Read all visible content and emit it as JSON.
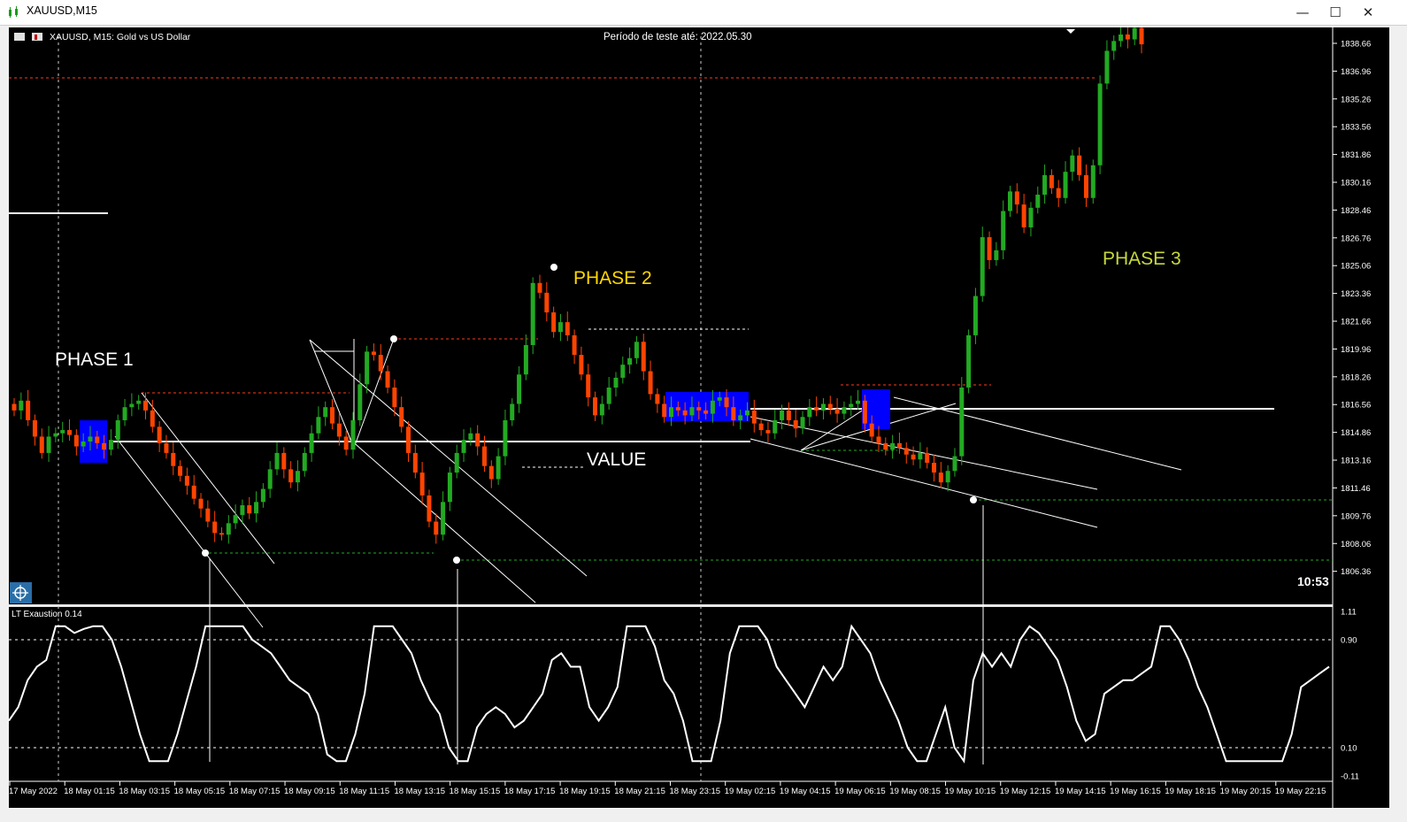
{
  "window": {
    "title": "XAUUSD,M15",
    "icon": "chart-icon",
    "buttons": {
      "minimize": "—",
      "maximize": "☐",
      "close": "✕"
    }
  },
  "chart_header": {
    "symbol_line": "XAUUSD, M15:  Gold vs US Dollar",
    "test_period": "Período de teste até: 2022.05.30",
    "clock": "10:53"
  },
  "annotations": {
    "phase1": "PHASE 1",
    "phase2": "PHASE 2",
    "phase3": "PHASE 3",
    "value": "VALUE"
  },
  "indicator": {
    "name": "LT Exaustion 0.14",
    "scale_labels": [
      "1.11",
      "0.90",
      "0.10",
      "-0.11"
    ],
    "levels": {
      "upper": 0.9,
      "lower": 0.1,
      "max": 1.11,
      "min": -0.11
    }
  },
  "colors": {
    "background": "#000000",
    "bull": "#22aa22",
    "bear": "#ff4400",
    "phase1_text": "#ffffff",
    "phase2_text": "#ffd700",
    "phase3_text": "#c8d83a",
    "box": "#0000ff"
  },
  "chart_data": {
    "type": "candlestick",
    "symbol": "XAUUSD",
    "timeframe": "M15",
    "y_ticks": [
      "1838.66",
      "1836.96",
      "1835.26",
      "1833.56",
      "1831.86",
      "1830.16",
      "1828.46",
      "1826.76",
      "1825.06",
      "1823.36",
      "1821.66",
      "1819.96",
      "1818.26",
      "1816.56",
      "1814.86",
      "1813.16",
      "1811.46",
      "1809.76",
      "1808.06",
      "1806.36"
    ],
    "ylim": [
      1805.8,
      1839.2
    ],
    "x_ticks": [
      "17 May 2022",
      "18 May 01:15",
      "18 May 03:15",
      "18 May 05:15",
      "18 May 07:15",
      "18 May 09:15",
      "18 May 11:15",
      "18 May 13:15",
      "18 May 15:15",
      "18 May 17:15",
      "18 May 19:15",
      "18 May 21:15",
      "18 May 23:15",
      "19 May 02:15",
      "19 May 04:15",
      "19 May 06:15",
      "19 May 08:15",
      "19 May 10:15",
      "19 May 12:15",
      "19 May 14:15",
      "19 May 16:15",
      "19 May 18:15",
      "19 May 20:15",
      "19 May 22:15"
    ],
    "closes": [
      1816.2,
      1816.8,
      1815.6,
      1814.6,
      1813.6,
      1814.6,
      1814.8,
      1815.0,
      1814.7,
      1814.0,
      1814.3,
      1814.6,
      1814.2,
      1813.8,
      1814.4,
      1815.6,
      1816.4,
      1816.6,
      1816.8,
      1816.2,
      1815.2,
      1814.2,
      1813.6,
      1812.8,
      1812.2,
      1811.6,
      1810.8,
      1810.2,
      1809.4,
      1808.7,
      1808.6,
      1809.3,
      1809.8,
      1810.4,
      1809.9,
      1810.6,
      1811.4,
      1812.6,
      1813.6,
      1812.6,
      1811.8,
      1812.5,
      1813.6,
      1814.8,
      1815.8,
      1816.4,
      1815.4,
      1814.6,
      1813.8,
      1815.6,
      1817.8,
      1819.8,
      1819.6,
      1818.6,
      1817.6,
      1816.4,
      1815.2,
      1813.6,
      1812.4,
      1811.0,
      1809.4,
      1808.6,
      1810.6,
      1812.4,
      1813.6,
      1814.4,
      1814.8,
      1814.0,
      1812.8,
      1812.0,
      1813.4,
      1815.6,
      1816.6,
      1818.4,
      1820.2,
      1824.0,
      1823.4,
      1822.2,
      1821.0,
      1821.6,
      1820.8,
      1819.6,
      1818.4,
      1817.0,
      1815.9,
      1816.6,
      1817.6,
      1818.2,
      1819.0,
      1819.4,
      1820.4,
      1818.6,
      1817.2,
      1816.6,
      1815.8,
      1816.4,
      1816.2,
      1815.9,
      1816.4,
      1816.2,
      1816.0,
      1816.8,
      1817.0,
      1816.4,
      1815.6,
      1815.9,
      1816.2,
      1815.4,
      1815.0,
      1814.8,
      1815.6,
      1816.2,
      1815.6,
      1815.1,
      1815.8,
      1816.4,
      1816.2,
      1816.6,
      1816.3,
      1816.0,
      1816.4,
      1816.6,
      1816.8,
      1815.4,
      1814.6,
      1814.2,
      1813.8,
      1814.2,
      1813.9,
      1813.5,
      1813.2,
      1813.6,
      1813.0,
      1812.4,
      1811.8,
      1812.5,
      1813.4,
      1817.6,
      1820.8,
      1823.2,
      1826.8,
      1825.4,
      1826.0,
      1828.4,
      1829.6,
      1828.8,
      1827.4,
      1828.6,
      1829.4,
      1830.6,
      1829.8,
      1829.2,
      1830.8,
      1831.8,
      1830.6,
      1829.2,
      1831.2,
      1836.2,
      1838.2,
      1838.8,
      1839.2,
      1838.9,
      1839.6,
      1838.6
    ],
    "series_names": [
      "XAUUSD M15"
    ]
  },
  "osc_data": [
    0.3,
    0.4,
    0.6,
    0.7,
    0.75,
    1.0,
    1.0,
    0.95,
    0.98,
    1.0,
    1.0,
    0.9,
    0.7,
    0.45,
    0.2,
    0.0,
    0.0,
    0.0,
    0.2,
    0.45,
    0.7,
    1.0,
    1.0,
    1.0,
    1.0,
    1.0,
    0.9,
    0.85,
    0.8,
    0.7,
    0.6,
    0.55,
    0.5,
    0.35,
    0.05,
    0.0,
    0.0,
    0.2,
    0.5,
    1.0,
    1.0,
    1.0,
    0.9,
    0.8,
    0.6,
    0.45,
    0.35,
    0.1,
    0.0,
    0.0,
    0.25,
    0.35,
    0.4,
    0.35,
    0.25,
    0.3,
    0.4,
    0.5,
    0.75,
    0.8,
    0.7,
    0.7,
    0.4,
    0.3,
    0.4,
    0.55,
    1.0,
    1.0,
    1.0,
    0.85,
    0.6,
    0.5,
    0.3,
    0.0,
    0.0,
    0.0,
    0.3,
    0.8,
    1.0,
    1.0,
    1.0,
    0.9,
    0.7,
    0.6,
    0.5,
    0.4,
    0.55,
    0.7,
    0.6,
    0.7,
    1.0,
    0.9,
    0.8,
    0.6,
    0.45,
    0.3,
    0.1,
    0.0,
    0.0,
    0.2,
    0.4,
    0.1,
    0.0,
    0.6,
    0.8,
    0.7,
    0.8,
    0.7,
    0.9,
    1.0,
    0.95,
    0.85,
    0.75,
    0.55,
    0.3,
    0.15,
    0.2,
    0.5,
    0.55,
    0.6,
    0.6,
    0.65,
    0.7,
    1.0,
    1.0,
    0.9,
    0.75,
    0.55,
    0.4,
    0.2,
    0.0,
    0.0,
    0.0,
    0.0,
    0.0,
    0.0,
    0.0,
    0.2,
    0.55,
    0.6,
    0.65,
    0.7
  ]
}
